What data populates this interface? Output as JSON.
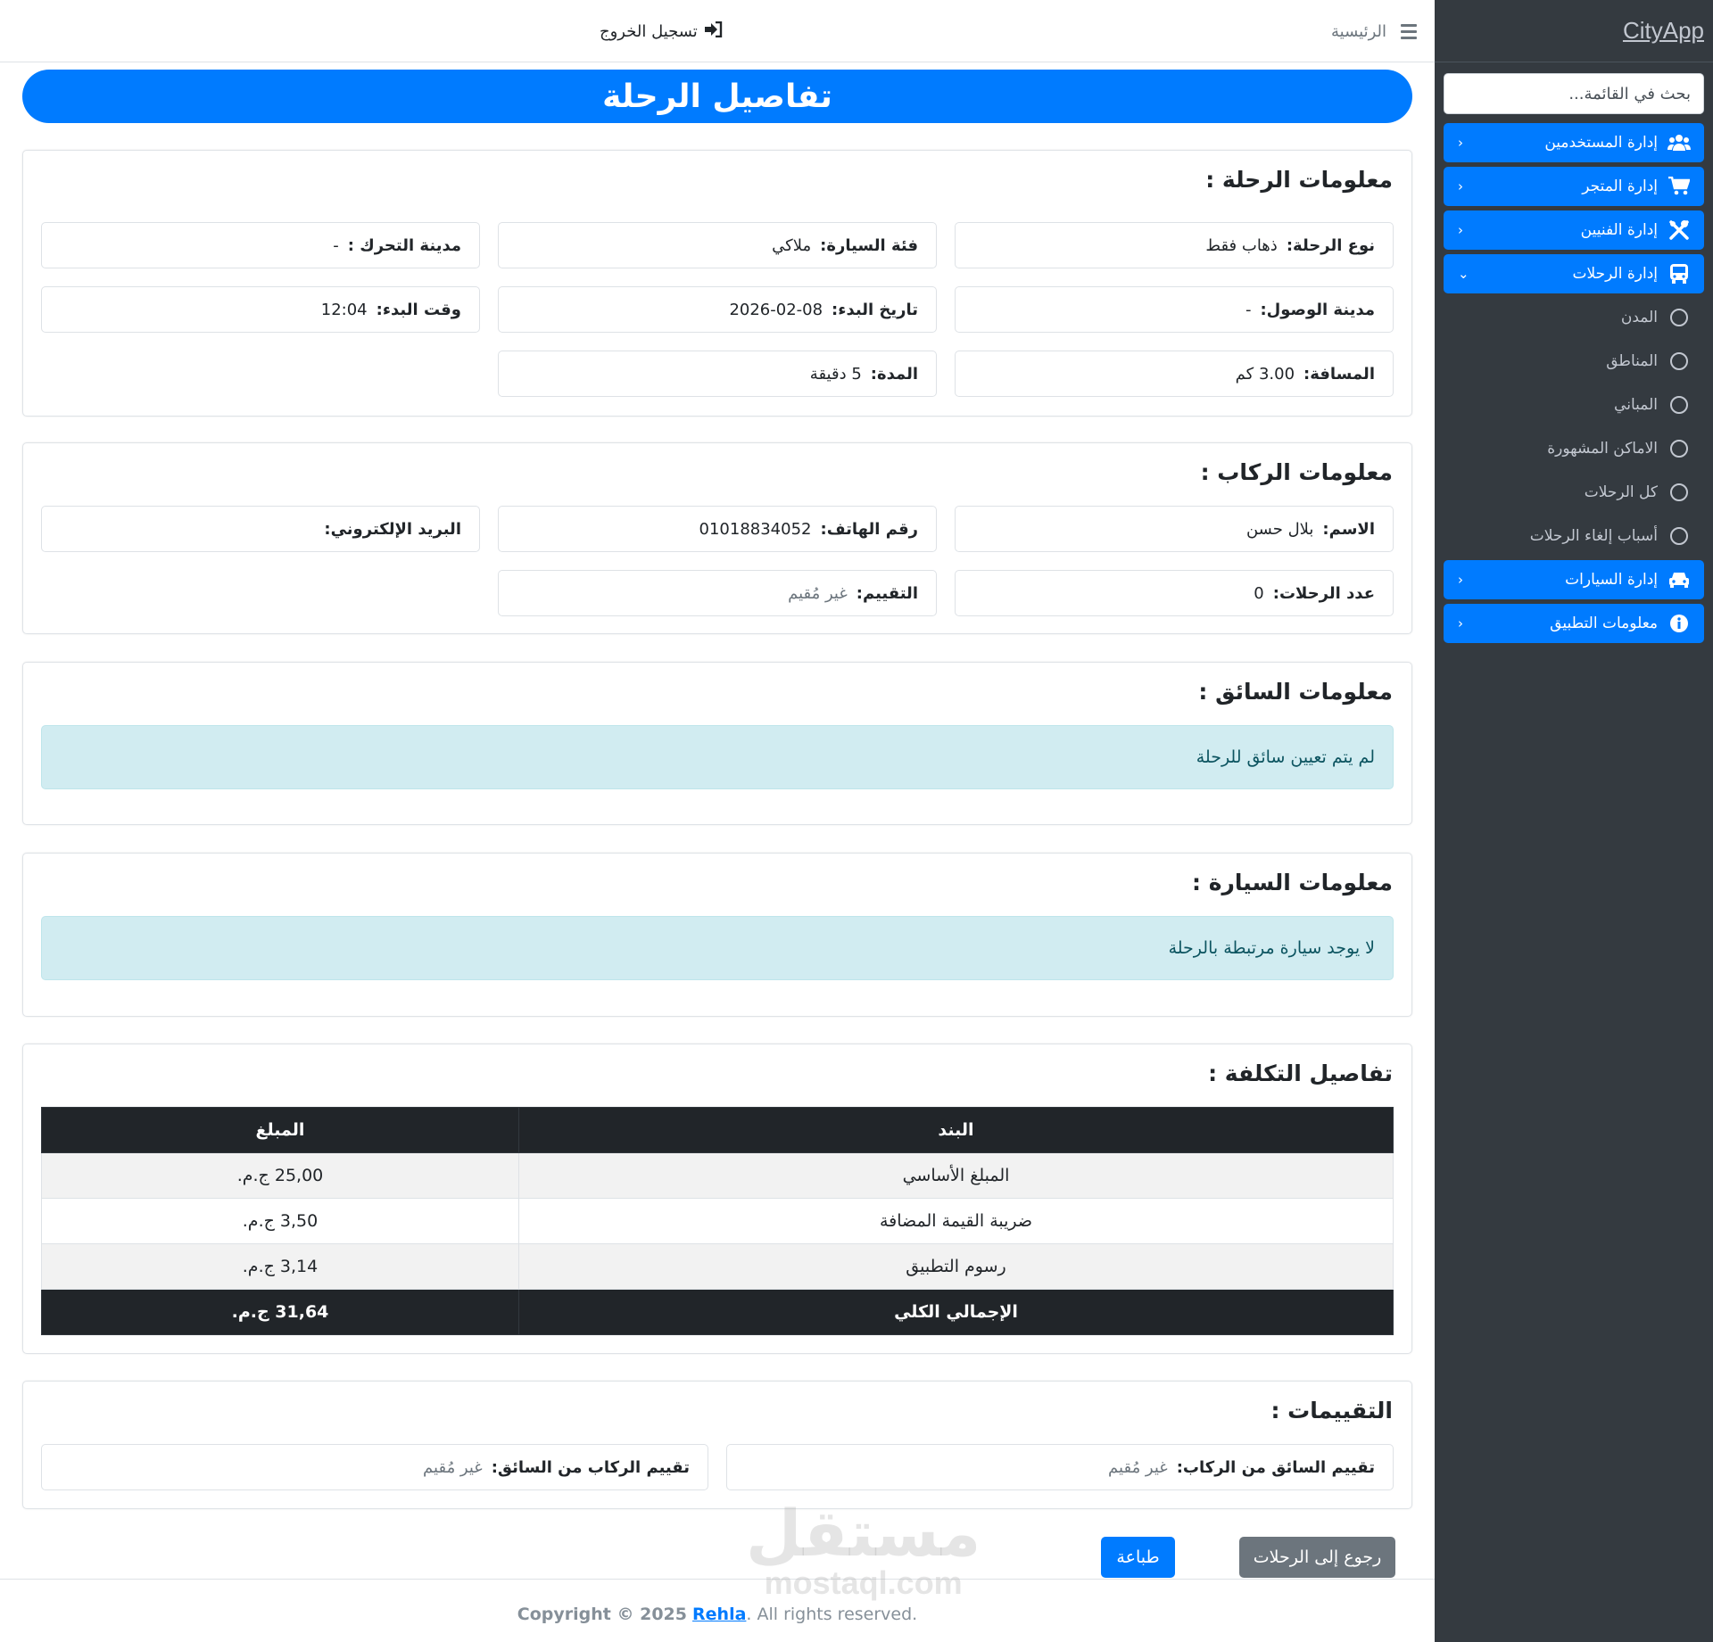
{
  "app": {
    "brand": "CityApp"
  },
  "topbar": {
    "home_label": "الرئيسية",
    "logout_label": "تسجيل الخروج"
  },
  "sidebar": {
    "search_placeholder": "بحث في القائمة...",
    "items": [
      {
        "label": "إدارة المستخدمين",
        "icon": "users-icon"
      },
      {
        "label": "إدارة المتجر",
        "icon": "cart-icon"
      },
      {
        "label": "إدارة الفنيين",
        "icon": "tools-icon"
      },
      {
        "label": "إدارة الرحلات",
        "icon": "bus-icon",
        "expanded": true,
        "children": [
          "المدن",
          "المناطق",
          "المباني",
          "الاماكن المشهورة",
          "كل الرحلات",
          "أسباب إلغاء الرحلات"
        ]
      },
      {
        "label": "إدارة السيارات",
        "icon": "car-icon"
      },
      {
        "label": "معلومات التطبيق",
        "icon": "info-icon"
      }
    ]
  },
  "page": {
    "title": "تفاصيل الرحلة"
  },
  "trip": {
    "heading": "معلومات الرحلة :",
    "type": {
      "label": "نوع الرحلة:",
      "value": "ذهاب فقط"
    },
    "car_category": {
      "label": "فئة السيارة:",
      "value": "ملاكي"
    },
    "departure_city": {
      "label": "مدينة التحرك :",
      "value": "-"
    },
    "arrival_city": {
      "label": "مدينة الوصول:",
      "value": "-"
    },
    "start_date": {
      "label": "تاريخ البدء:",
      "value": "2026-02-08"
    },
    "start_time": {
      "label": "وقت البدء:",
      "value": "12:04"
    },
    "distance": {
      "label": "المسافة:",
      "value": "3.00 كم"
    },
    "duration": {
      "label": "المدة:",
      "value": "5 دقيقة"
    }
  },
  "rider": {
    "heading": "معلومات الركاب :",
    "name": {
      "label": "الاسم:",
      "value": "بلال حسن"
    },
    "phone": {
      "label": "رقم الهاتف:",
      "value": "01018834052"
    },
    "email": {
      "label": "البريد الإلكتروني:",
      "value": ""
    },
    "trips_count": {
      "label": "عدد الرحلات:",
      "value": "0"
    },
    "rating": {
      "label": "التقييم:",
      "value": "غير مُقيم"
    }
  },
  "driver": {
    "heading": "معلومات السائق :",
    "message": "لم يتم تعيين سائق للرحلة"
  },
  "car": {
    "heading": "معلومات السيارة :",
    "message": "لا يوجد سيارة مرتبطة بالرحلة"
  },
  "cost": {
    "heading": "تفاصيل التكلفة :",
    "columns": {
      "item": "البند",
      "amount": "المبلغ"
    },
    "rows": [
      {
        "item": "المبلغ الأساسي",
        "amount": "25,00 ج.م."
      },
      {
        "item": "ضريبة القيمة المضافة",
        "amount": "3,50 ج.م."
      },
      {
        "item": "رسوم التطبيق",
        "amount": "3,14 ج.م."
      }
    ],
    "total": {
      "item": "الإجمالي الكلي",
      "amount": "31,64 ج.م."
    }
  },
  "ratings": {
    "heading": "التقييمات :",
    "driver_from_rider": {
      "label": "تقييم السائق من الركاب:",
      "value": "غير مُقيم"
    },
    "rider_from_driver": {
      "label": "تقييم الركاب من السائق:",
      "value": "غير مُقيم"
    }
  },
  "actions": {
    "back_label": "رجوع إلى الرحلات",
    "print_label": "طباعة"
  },
  "footer": {
    "copyright": "Copyright © 2025",
    "brand": "Rehla",
    "rights": ". All rights reserved."
  },
  "watermark": {
    "arabic": "مستقل",
    "latin": "mostaql.com"
  },
  "colors": {
    "primary": "#007bff",
    "sidebar": "#343a40",
    "dark": "#212529",
    "info_bg": "#d1ecf1",
    "secondary": "#6c757d"
  }
}
